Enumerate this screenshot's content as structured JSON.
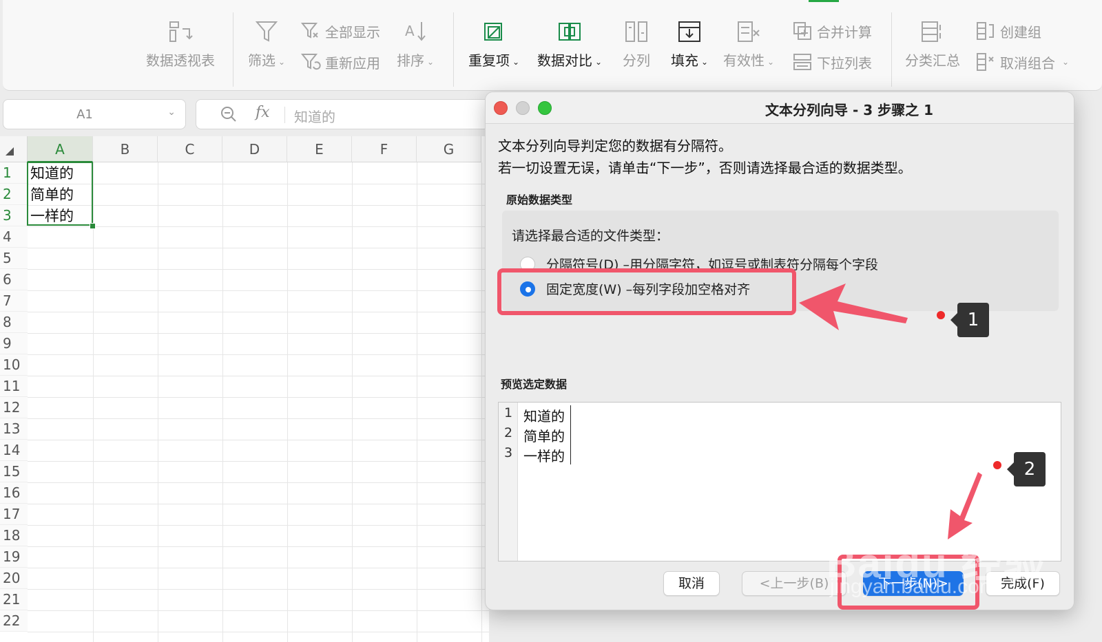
{
  "ribbon": {
    "pivot_label": "数据透视表",
    "filter_label": "筛选",
    "show_all_label": "全部显示",
    "reapply_label": "重新应用",
    "sort_label": "排序",
    "duplicates_label": "重复项",
    "compare_label": "数据对比",
    "split_label": "分列",
    "fill_label": "填充",
    "validity_label": "有效性",
    "consolidate_label": "合并计算",
    "dropdown_list_label": "下拉列表",
    "subtotal_label": "分类汇总",
    "group_label": "创建组",
    "ungroup_label": "取消组合"
  },
  "formula_bar": {
    "cell_ref": "A1",
    "fx": "fx",
    "value": "知道的"
  },
  "sheet": {
    "columns": [
      "A",
      "B",
      "C",
      "D",
      "E",
      "F",
      "G"
    ],
    "rows": [
      "1",
      "2",
      "3",
      "4",
      "5",
      "6",
      "7",
      "8",
      "9",
      "10",
      "11",
      "12",
      "13",
      "14",
      "15",
      "16",
      "17",
      "18",
      "19",
      "20",
      "21",
      "22"
    ],
    "cells": {
      "A1": "知道的",
      "A2": "简单的",
      "A3": "一样的"
    }
  },
  "dialog": {
    "title": "文本分列向导 - 3 步骤之 1",
    "intro_line1": "文本分列向导判定您的数据有分隔符。",
    "intro_line2": "若一切设置无误，请单击“下一步”，否则请选择最合适的数据类型。",
    "group_label": "原始数据类型",
    "group_prompt": "请选择最合适的文件类型：",
    "option_delimited": "分隔符号(D)   –用分隔字符，如逗号或制表符分隔每个字段",
    "option_fixed": "固定宽度(W)   –每列字段加空格对齐",
    "selected_option": "fixed",
    "preview_label": "预览选定数据",
    "preview_rows": [
      {
        "num": "1",
        "text": "知道的"
      },
      {
        "num": "2",
        "text": "简单的"
      },
      {
        "num": "3",
        "text": "一样的"
      }
    ],
    "cancel_label": "取消",
    "back_label": "<上一步(B)",
    "next_label": "下一步(N)>",
    "finish_label": "完成(F)"
  },
  "annotations": {
    "callout1": "1",
    "callout2": "2",
    "highlight_color": "#f0566b"
  },
  "watermark": {
    "brand": "Baidu 经验",
    "url": "jingyan.baidu.com"
  }
}
